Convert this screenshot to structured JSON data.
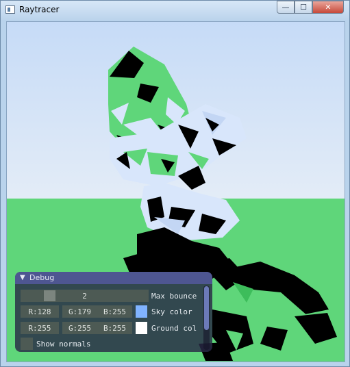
{
  "window": {
    "title": "Raytracer",
    "controls": {
      "minimize": "—",
      "maximize": "☐",
      "close": "✕"
    }
  },
  "colors": {
    "sky_top": "#c7dcf7",
    "sky_horizon": "#e3ecf8",
    "ground": "#5fd67a",
    "mesh_light": "#d8e6fb",
    "mesh_dark": "#000000",
    "panel_header": "#4e5691"
  },
  "debug_panel": {
    "title": "Debug",
    "max_bounce": {
      "value": "2",
      "label": "Max bounce",
      "level": 0.25
    },
    "sky_color": {
      "r": "R:128",
      "g": "G:179",
      "b": "B:255",
      "label": "Sky color",
      "swatch": "#80b3ff"
    },
    "ground_color": {
      "r": "R:255",
      "g": "G:255",
      "b": "B:255",
      "label": "Ground col",
      "swatch": "#ffffff"
    },
    "show_normals": {
      "label": "Show normals",
      "checked": false
    }
  }
}
